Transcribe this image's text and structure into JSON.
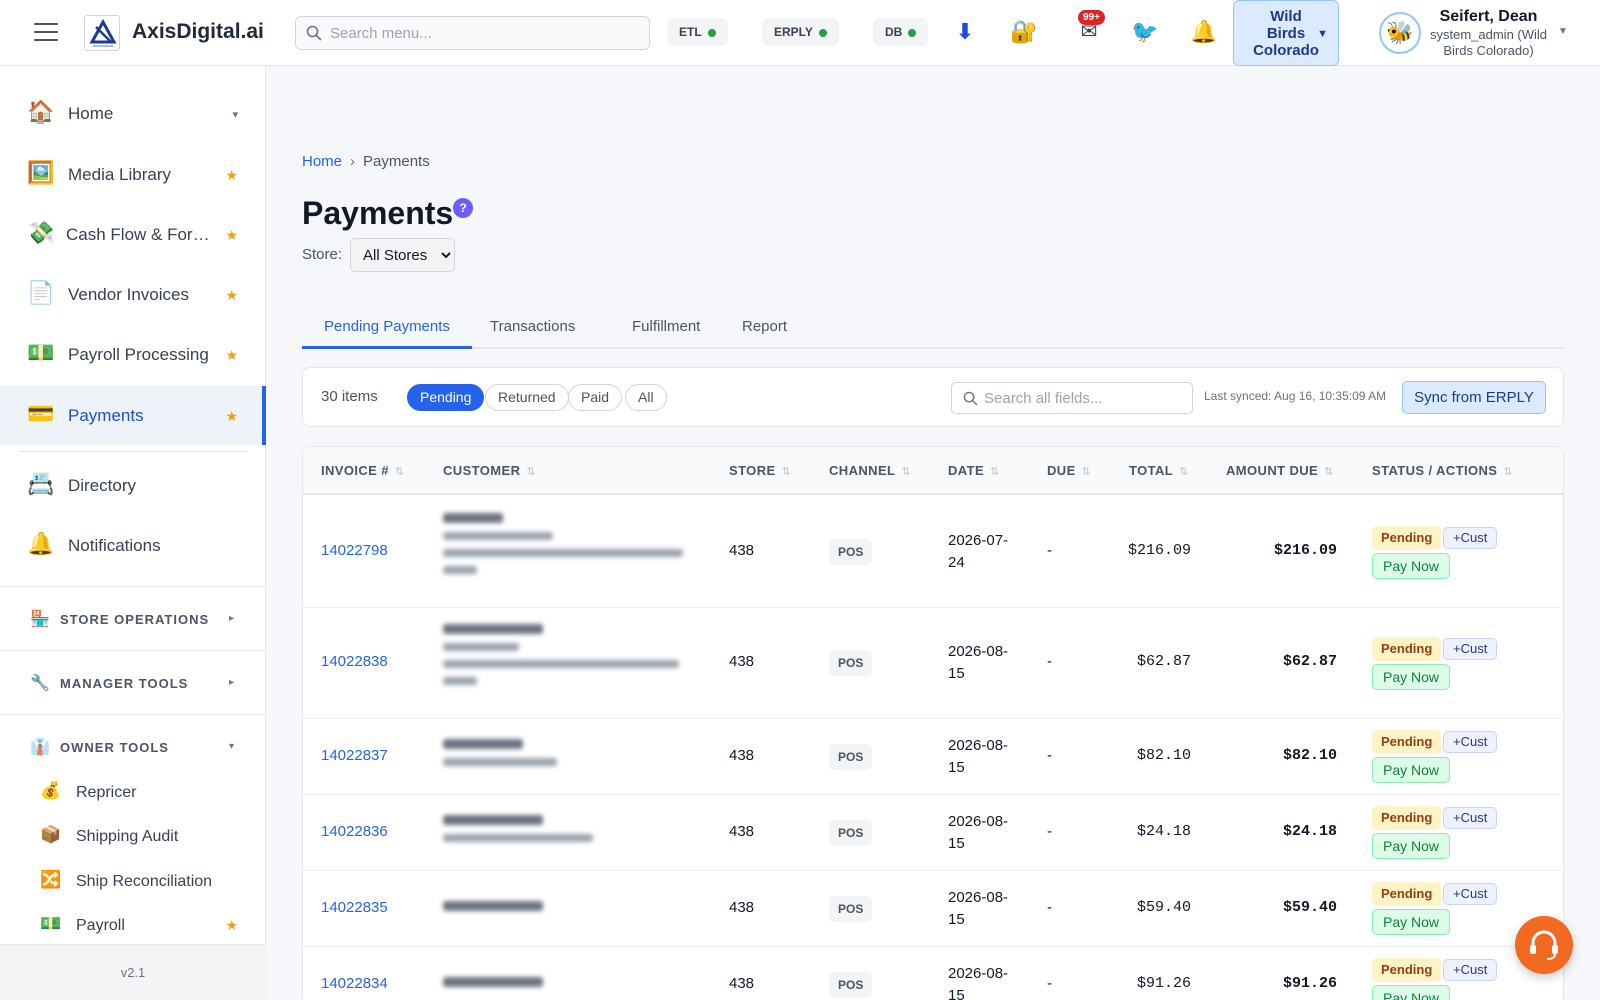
{
  "header": {
    "brand": "AxisDigital.ai",
    "search_placeholder": "Search menu...",
    "status": [
      {
        "label": "ETL",
        "color": "#22a046"
      },
      {
        "label": "ERPLY",
        "color": "#22a046"
      },
      {
        "label": "DB",
        "color": "#22a046"
      }
    ],
    "mail_badge": "99+",
    "store_switch": {
      "line1": "Wild",
      "line2": "Birds",
      "line3": "Colorado"
    },
    "user": {
      "name": "Seifert, Dean",
      "role": "system_admin (Wild Birds Colorado)"
    }
  },
  "sidebar": {
    "items": [
      {
        "label": "Home",
        "icon": "house-icon",
        "trail": "▾"
      },
      {
        "label": "Media Library",
        "icon": "picture-icon",
        "trail": "★"
      },
      {
        "label": "Cash Flow & For…",
        "icon": "money-wings-icon",
        "trail": "★"
      },
      {
        "label": "Vendor Invoices",
        "icon": "document-icon",
        "trail": "★"
      },
      {
        "label": "Payroll Processing",
        "icon": "dollar-bill-icon",
        "trail": "★"
      },
      {
        "label": "Payments",
        "icon": "credit-card-icon",
        "trail": "★"
      },
      {
        "label": "Directory",
        "icon": "card-index-icon",
        "trail": ""
      },
      {
        "label": "Notifications",
        "icon": "bell-icon",
        "trail": ""
      }
    ],
    "sections": [
      {
        "label": "STORE OPERATIONS",
        "icon": "store-icon",
        "trail": "▸"
      },
      {
        "label": "MANAGER TOOLS",
        "icon": "wrench-icon",
        "trail": "▸"
      },
      {
        "label": "OWNER TOOLS",
        "icon": "necktie-icon",
        "trail": "▾"
      }
    ],
    "owner_tools": [
      {
        "label": "Repricer",
        "icon": "money-bag-icon",
        "trail": ""
      },
      {
        "label": "Shipping Audit",
        "icon": "package-icon",
        "trail": ""
      },
      {
        "label": "Ship Reconciliation",
        "icon": "shuffle-icon",
        "trail": ""
      },
      {
        "label": "Payroll",
        "icon": "dollar-bill-icon",
        "trail": "★"
      }
    ],
    "version": "v2.1"
  },
  "main": {
    "breadcrumb": {
      "home": "Home",
      "separator": "›",
      "current": "Payments"
    },
    "title": "Payments",
    "help": "?",
    "store_label": "Store:",
    "store_value": "All Stores",
    "tabs": [
      "Pending Payments",
      "Transactions",
      "Fulfillment",
      "Report"
    ],
    "active_tab": "Pending Payments",
    "filter": {
      "count": "30 items",
      "chips": [
        "Pending",
        "Returned",
        "Paid",
        "All"
      ],
      "active_chip": "Pending",
      "search_placeholder": "Search all fields...",
      "last_synced": "Last synced: Aug 16, 10:35:09 AM",
      "sync_button": "Sync from ERPLY"
    },
    "table": {
      "columns": [
        "INVOICE #",
        "CUSTOMER",
        "STORE",
        "CHANNEL",
        "DATE",
        "DUE",
        "TOTAL",
        "AMOUNT DUE",
        "STATUS / ACTIONS"
      ],
      "sort_glyph": "⇅",
      "rows": [
        {
          "invoice": "14022798",
          "store": "438",
          "channel": "POS",
          "date_line1": "2026-07-",
          "date_line2": "24",
          "due": "-",
          "total": "$216.09",
          "amount_due": "$216.09",
          "status": "Pending",
          "cust": "+Cust",
          "action": "Pay Now"
        },
        {
          "invoice": "14022838",
          "store": "438",
          "channel": "POS",
          "date_line1": "2026-08-",
          "date_line2": "15",
          "due": "-",
          "total": "$62.87",
          "amount_due": "$62.87",
          "status": "Pending",
          "cust": "+Cust",
          "action": "Pay Now"
        },
        {
          "invoice": "14022837",
          "store": "438",
          "channel": "POS",
          "date_line1": "2026-08-",
          "date_line2": "15",
          "due": "-",
          "total": "$82.10",
          "amount_due": "$82.10",
          "status": "Pending",
          "cust": "+Cust",
          "action": "Pay Now"
        },
        {
          "invoice": "14022836",
          "store": "438",
          "channel": "POS",
          "date_line1": "2026-08-",
          "date_line2": "15",
          "due": "-",
          "total": "$24.18",
          "amount_due": "$24.18",
          "status": "Pending",
          "cust": "+Cust",
          "action": "Pay Now"
        },
        {
          "invoice": "14022835",
          "store": "438",
          "channel": "POS",
          "date_line1": "2026-08-",
          "date_line2": "15",
          "due": "-",
          "total": "$59.40",
          "amount_due": "$59.40",
          "status": "Pending",
          "cust": "+Cust",
          "action": "Pay Now"
        },
        {
          "invoice": "14022834",
          "store": "438",
          "channel": "POS",
          "date_line1": "2026-08-",
          "date_line2": "15",
          "due": "-",
          "total": "$91.26",
          "amount_due": "$91.26",
          "status": "Pending",
          "cust": "+Cust",
          "action": "Pay Now"
        }
      ]
    }
  },
  "colors": {
    "accent": "#2563eb",
    "fab": "#f26a22",
    "pending_bg": "#fef3c7",
    "pay_bg": "#dcfce7"
  }
}
